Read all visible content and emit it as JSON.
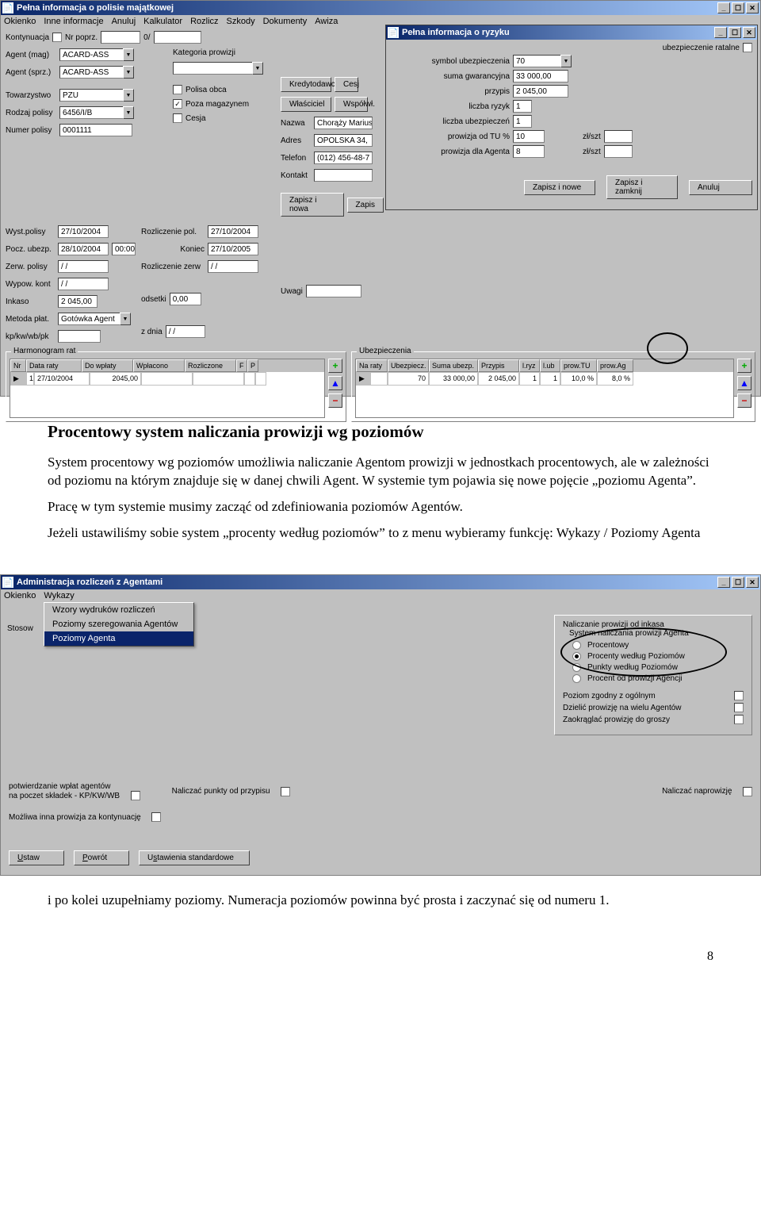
{
  "win1": {
    "title": "Pełna informacja o polisie majątkowej",
    "menus": [
      "Okienko",
      "Inne informacje",
      "Anuluj",
      "Kalkulator",
      "Rozlicz",
      "Szkody",
      "Dokumenty",
      "Awiza"
    ],
    "kontynuacja_label": "Kontynuacja",
    "nr_poprz_label": "Nr poprz.",
    "nr_poprz_sep": "0/",
    "agent_mag_label": "Agent (mag)",
    "agent_sprz_label": "Agent (sprz.)",
    "agent": "ACARD-ASS",
    "kategoria_label": "Kategoria prowizji",
    "towarzystwo_label": "Towarzystwo",
    "towarzystwo": "PZU",
    "rodzaj_label": "Rodzaj polisy",
    "rodzaj": "6456/I/B",
    "numer_label": "Numer polisy",
    "numer": "0001111",
    "polisa_obca_label": "Polisa obca",
    "poza_mag_label": "Poza magazynem",
    "cesja_label": "Cesja",
    "kredytodawca": "Kredytodawca",
    "cesj": "Cesj",
    "wlasciciel": "Właściciel",
    "wspolwl": "Współwł.",
    "nazwa_label": "Nazwa",
    "nazwa": "Chorąży Marius",
    "adres_label": "Adres",
    "adres": "OPOLSKA 34,",
    "telefon_label": "Telefon",
    "telefon": "(012) 456-48-7",
    "kontakt_label": "Kontakt",
    "wyst_label": "Wyst.polisy",
    "wyst": "27/10/2004",
    "pocz_label": "Pocz. ubezp.",
    "pocz": "28/10/2004",
    "pocz_time": "00:00",
    "zerw_label": "Zerw. polisy",
    "zerw": "/ /",
    "wypow_label": "Wypow. kont",
    "wypow": "/ /",
    "inkaso_label": "Inkaso",
    "inkaso": "2 045,00",
    "odsetki_label": "odsetki",
    "odsetki": "0,00",
    "metoda_label": "Metoda płat.",
    "metoda": "Gotówka Agent",
    "kp_label": "kp/kw/wb/pk",
    "z_dnia_label": "z dnia",
    "z_dnia": "/ /",
    "rozl_pol_label": "Rozliczenie pol.",
    "rozl_pol": "27/10/2004",
    "koniec_label": "Koniec",
    "koniec": "27/10/2005",
    "rozl_zerw_label": "Rozliczenie zerw",
    "rozl_zerw": "/ /",
    "uwagi_label": "Uwagi",
    "zapisz_nowa": "Zapisz i nowa",
    "zapis": "Zapis",
    "harm_title": "Harmonogram rat",
    "harm_cols": [
      "Nr",
      "Data raty",
      "Do wpłaty",
      "Wpłacono",
      "Rozliczone",
      "F",
      "P"
    ],
    "harm_row": [
      "1",
      "27/10/2004",
      "2045,00",
      "",
      "",
      "",
      ""
    ],
    "ubez_title": "Ubezpieczenia",
    "ubez_cols": [
      "Na raty",
      "Ubezpiecz.",
      "Suma ubezp.",
      "Przypis",
      "l.ryz",
      "l.ub",
      "prow.TU",
      "prow.Ag"
    ],
    "ubez_row": [
      "",
      "70",
      "33 000,00",
      "2 045,00",
      "1",
      "1",
      "10,0 %",
      "8,0 %"
    ]
  },
  "win2": {
    "title": "Pełna informacja o ryzyku",
    "ubez_ratalne_label": "ubezpieczenie ratalne",
    "symbol_label": "symbol ubezpieczenia",
    "symbol": "70",
    "suma_label": "suma gwarancyjna",
    "suma": "33 000,00",
    "przypis_label": "przypis",
    "przypis": "2 045,00",
    "liczba_ryzyk_label": "liczba ryzyk",
    "liczba_ryzyk": "1",
    "liczba_ubez_label": "liczba ubezpieczeń",
    "liczba_ubez": "1",
    "prow_tu_label": "prowizja od TU %",
    "prow_tu": "10",
    "zl_szt": "zł/szt",
    "prow_ag_label": "prowizja dla Agenta",
    "prow_ag": "8",
    "zapisz_nowe": "Zapisz i nowe",
    "zapisz_zamknij": "Zapisz i zamknij",
    "anuluj": "Anuluj"
  },
  "text1": {
    "h": "Procentowy system naliczania prowizji wg poziomów",
    "p1": "System procentowy wg poziomów umożliwia naliczanie Agentom prowizji w jednostkach procentowych, ale w zależności od poziomu na którym znajduje się w danej chwili Agent. W systemie tym pojawia się nowe pojęcie „poziomu Agenta”.",
    "p2": "Pracę w tym systemie musimy zacząć od zdefiniowania poziomów Agentów.",
    "p3": "Jeżeli ustawiliśmy sobie system „procenty według poziomów” to z menu wybieramy funkcję: Wykazy / Poziomy Agenta"
  },
  "win3": {
    "title": "Administracja rozliczeń z Agentami",
    "menus": [
      "Okienko",
      "Wykazy"
    ],
    "menu_items": [
      "Wzory wydruków rozliczeń",
      "Poziomy szeregowania Agentów",
      "Poziomy Agenta"
    ],
    "stosow": "Stosow",
    "nal_header": "Naliczanie prowizji od inkasa",
    "sys_header": "System naliczania prowizji Agenta",
    "radios": [
      "Procentowy",
      "Procenty według Poziomów",
      "Punkty według Poziomów",
      "Procent od prowizji Agencji"
    ],
    "poziom_zgodny": "Poziom zgodny z ogólnym",
    "dzielic": "Dzielić prowizję na wielu Agentów",
    "zaokr": "Zaokrąglać prowizję do groszy",
    "potw": "potwierdzanie wpłat agentów",
    "na_poczet": "na poczet składek - KP/KW/WB",
    "naliczac_punkty": "Naliczać punkty od przypisu",
    "naliczac_napr": "Naliczać naprowizję",
    "mozliwa": "Możliwa inna prowizja za kontynuację",
    "ustaw": "Ustaw",
    "powrot": "Powrót",
    "ust_std": "Ustawienia standardowe"
  },
  "text2": {
    "p": "i po kolei uzupełniamy poziomy. Numeracja poziomów powinna być prosta i zaczynać się od numeru 1."
  },
  "pagenum": "8"
}
